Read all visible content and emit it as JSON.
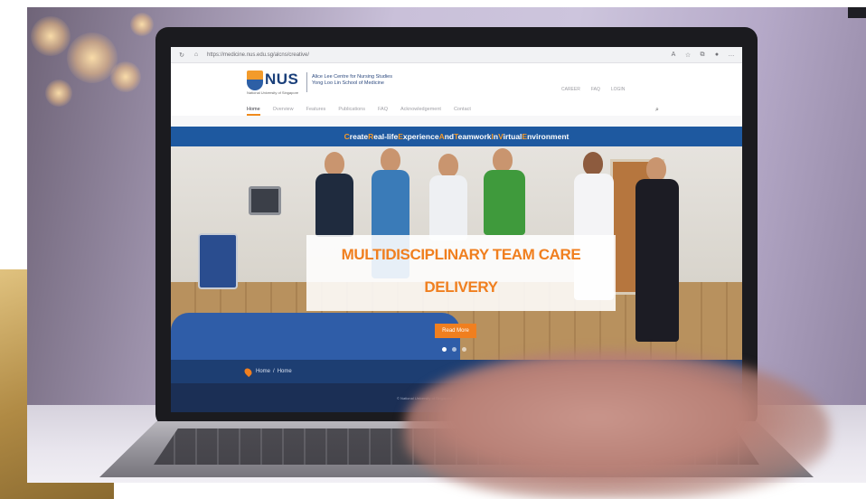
{
  "browser": {
    "url": "https://medicine.nus.edu.sg/alcns/creative/",
    "icons": [
      "refresh-icon",
      "lock-icon",
      "translate-icon",
      "favorite-icon",
      "collections-icon",
      "profile-icon"
    ]
  },
  "header": {
    "logo_text": "NUS",
    "logo_sub": "National University of Singapore",
    "department_line1": "Alice Lee Centre for Nursing Studies",
    "department_line2": "Yong Loo Lin School of Medicine",
    "links": [
      "CAREER",
      "FAQ",
      "LOGIN"
    ]
  },
  "nav": {
    "items": [
      "Home",
      "Overview",
      "Features",
      "Publications",
      "FAQ",
      "Acknowledgement",
      "Contact"
    ],
    "active": "Home"
  },
  "banner": {
    "parts": [
      {
        "cap": "C",
        "rest": "reate "
      },
      {
        "cap": "R",
        "rest": "eal-life "
      },
      {
        "cap": "E",
        "rest": "xperience "
      },
      {
        "cap": "A",
        "rest": "nd "
      },
      {
        "cap": "T",
        "rest": "eamwork "
      },
      {
        "cap": "I",
        "rest": "n "
      },
      {
        "cap": "V",
        "rest": "irtual "
      },
      {
        "cap": "E",
        "rest": "nvironment"
      }
    ]
  },
  "hero": {
    "title_line1": "MULTIDISCIPLINARY TEAM CARE",
    "title_line2": "DELIVERY",
    "button": "Read More",
    "slide_count": 3,
    "active_slide": 1
  },
  "breadcrumb": {
    "home": "Home",
    "separator": "/",
    "current": "Home"
  },
  "footer": {
    "text": "© National University of Singapore"
  },
  "colors": {
    "accent": "#f07f1f",
    "banner_blue": "#1e59a0",
    "nav_dark": "#1d3e72",
    "gold": "#c9a35a"
  }
}
